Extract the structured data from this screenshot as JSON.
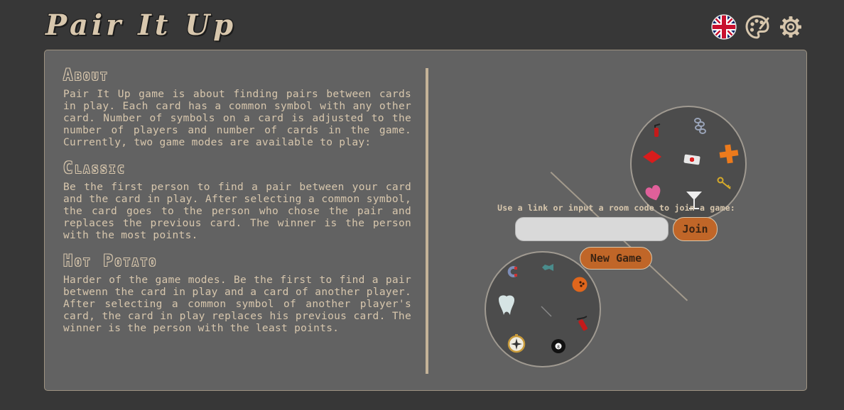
{
  "header": {
    "title": "Pair It Up",
    "icons": [
      "uk-flag-icon",
      "palette-icon",
      "gear-icon"
    ]
  },
  "about": {
    "heading": "About",
    "text": "Pair It Up game is about finding pairs between cards in play. Each card has a common symbol with any other card. Number of symbols on a card is adjusted to the number of players and number of cards in the game. Currently, two game modes are available to play:",
    "modes": [
      {
        "heading": "Classic",
        "text": "Be the first person to find a pair between your card and the card in play. After selecting a common symbol, the card goes to the person who chose the pair and replaces the previous card. The winner is the person with the most points."
      },
      {
        "heading": "Hot Potato",
        "text": "Harder of the game modes. Be the first to find a pair betwenn the card in play and a card of another player. After selecting a common symbol of another player's card, the card in play replaces his previous card. The winner is the person with the least points."
      }
    ]
  },
  "join": {
    "label": "Use a link or input a room code to join a game:",
    "input_value": "",
    "input_placeholder": "",
    "join_button": "Join",
    "new_game_button": "New Game"
  },
  "decor": {
    "card_top_symbols": [
      "fire-extinguisher-icon",
      "chain-icon",
      "diamond-icon",
      "first-aid-kit-icon",
      "cross-icon",
      "heart-icon",
      "cocktail-glass-icon",
      "key-icon"
    ],
    "card_bottom_symbols": [
      "magnet-icon",
      "fish-icon",
      "bowling-ball-icon",
      "tooth-icon",
      "needle-icon",
      "fire-extinguisher-icon",
      "compass-icon",
      "eight-ball-icon"
    ]
  },
  "colors": {
    "background": "#373737",
    "panel": "#626262",
    "text": "#d8c7ad",
    "accent": "#c06628"
  }
}
